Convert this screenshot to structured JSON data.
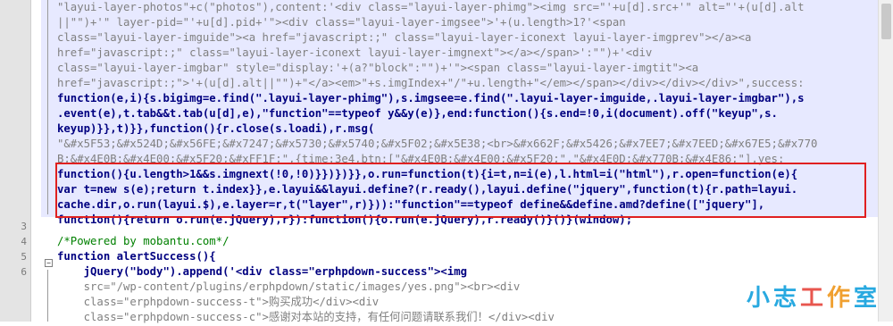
{
  "editor": {
    "line_numbers": [
      "3",
      "4",
      "5",
      "6"
    ],
    "code": {
      "l0": "\"layui-layer-photos\"+c(\"photos\"),content:'<div class=\"layui-layer-phimg\"><img src=\"'+u[d].src+'\" alt=\"'+(u[d].alt",
      "l1": "||\"\")+'\" layer-pid=\"'+u[d].pid+'\"><div class=\"layui-layer-imgsee\">'+(u.length>1?'<span",
      "l2": "class=\"layui-layer-imguide\"><a href=\"javascript:;\" class=\"layui-layer-iconext layui-layer-imgprev\"></a><a",
      "l3": "href=\"javascript:;\" class=\"layui-layer-iconext layui-layer-imgnext\"></a></span>':\"\")+'<div",
      "l4": "class=\"layui-layer-imgbar\" style=\"display:'+(a?\"block\":\"\")+'\"><span class=\"layui-layer-imgtit\"><a",
      "l5": "href=\"javascript:;\">'+(u[d].alt||\"\")+\"</a><em>\"+s.imgIndex+\"/\"+u.length+\"</em></span></div></div></div>\",success:",
      "l6": "function(e,i){s.bigimg=e.find(\".layui-layer-phimg\"),s.imgsee=e.find(\".layui-layer-imguide,.layui-layer-imgbar\"),s",
      "l7": ".event(e),t.tab&&t.tab(u[d],e),\"function\"==typeof y&&y(e)},end:function(){s.end=!0,i(document).off(\"keyup\",s.",
      "l8": "keyup)}},t)}},function(){r.close(s.loadi),r.msg(",
      "l9": "\"&#x5F53;&#x524D;&#x56FE;&#x7247;&#x5730;&#x5740;&#x5F02;&#x5E38;<br>&#x662F;&#x5426;&#x7EE7;&#x7EED;&#x67E5;&#x770",
      "l10": "B;&#x4E0B;&#x4E00;&#x5F20;&#xFF1F;\",{time:3e4,btn:[\"&#x4E0B;&#x4E00;&#x5F20;\",\"&#x4E0D;&#x770B;&#x4E86;\"],yes:",
      "l11": "function(){u.length>1&&s.imgnext(!0,!0)}})})}},o.run=function(t){i=t,n=i(e),l.html=i(\"html\"),r.open=function(e){",
      "l12": "var t=new s(e);return t.index}},e.layui&&layui.define?(r.ready(),layui.define(\"jquery\",function(t){r.path=layui.",
      "l13": "cache.dir,o.run(layui.$),e.layer=r,t(\"layer\",r)})):\"function\"==typeof define&&define.amd?define([\"jquery\"],",
      "l14": "function(){return o.run(e.jQuery),r}):function(){o.run(e.jQuery),r.ready()}()}(window);",
      "l15": "",
      "l16": "/*Powered by mobantu.com*/",
      "l17": "function alertSuccess(){",
      "l18": "    jQuery(\"body\").append('<div class=\"erphpdown-success\"><img",
      "l19": "    src=\"/wp-content/plugins/erphpdown/static/images/yes.png\"><br><div",
      "l20": "    class=\"erphpdown-success-t\">购买成功</div><div",
      "l21": "    class=\"erphpdown-success-c\">感谢对本站的支持，有任何问题请联系我们！</div><div"
    }
  },
  "watermark": [
    "小",
    "志",
    "工",
    "作",
    "室"
  ],
  "colors": {
    "highlight": "#e7e9ff",
    "redbox": "#e02020",
    "keyword": "#0000ff",
    "string": "#808080",
    "number": "#ff8000",
    "comment": "#008000"
  }
}
